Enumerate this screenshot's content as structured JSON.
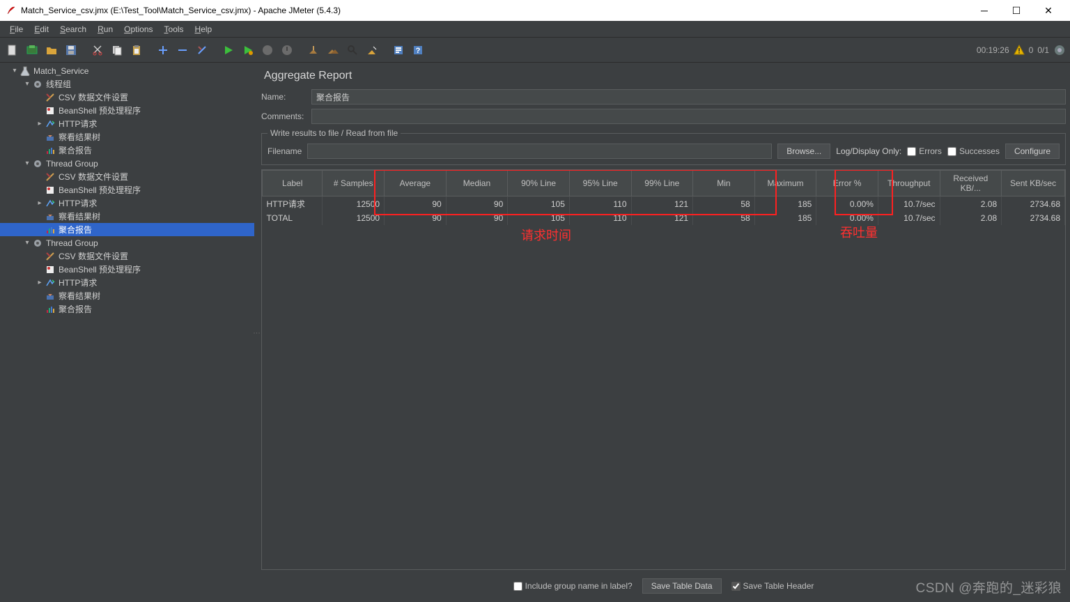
{
  "window": {
    "title": "Match_Service_csv.jmx (E:\\Test_Tool\\Match_Service_csv.jmx) - Apache JMeter (5.4.3)"
  },
  "menu": [
    "File",
    "Edit",
    "Search",
    "Run",
    "Options",
    "Tools",
    "Help"
  ],
  "toolbar_status": {
    "timer": "00:19:26",
    "warn_count": "0",
    "ratio": "0/1"
  },
  "tree": [
    {
      "depth": 0,
      "arrow": "▾",
      "icon": "flask",
      "label": "Match_Service"
    },
    {
      "depth": 1,
      "arrow": "▾",
      "icon": "gear",
      "label": "线程组"
    },
    {
      "depth": 2,
      "arrow": "",
      "icon": "csv",
      "label": "CSV 数据文件设置"
    },
    {
      "depth": 2,
      "arrow": "",
      "icon": "bean",
      "label": "BeanShell 预处理程序"
    },
    {
      "depth": 2,
      "arrow": "▸",
      "icon": "http",
      "label": "HTTP请求"
    },
    {
      "depth": 2,
      "arrow": "",
      "icon": "tree",
      "label": "察看结果树"
    },
    {
      "depth": 2,
      "arrow": "",
      "icon": "report",
      "label": "聚合报告"
    },
    {
      "depth": 1,
      "arrow": "▾",
      "icon": "gear",
      "label": "Thread Group"
    },
    {
      "depth": 2,
      "arrow": "",
      "icon": "csv",
      "label": "CSV 数据文件设置"
    },
    {
      "depth": 2,
      "arrow": "",
      "icon": "bean",
      "label": "BeanShell 预处理程序"
    },
    {
      "depth": 2,
      "arrow": "▸",
      "icon": "http",
      "label": "HTTP请求"
    },
    {
      "depth": 2,
      "arrow": "",
      "icon": "tree",
      "label": "察看结果树"
    },
    {
      "depth": 2,
      "arrow": "",
      "icon": "report",
      "label": "聚合报告",
      "selected": true
    },
    {
      "depth": 1,
      "arrow": "▾",
      "icon": "gear",
      "label": "Thread Group"
    },
    {
      "depth": 2,
      "arrow": "",
      "icon": "csv",
      "label": "CSV 数据文件设置"
    },
    {
      "depth": 2,
      "arrow": "",
      "icon": "bean",
      "label": "BeanShell 预处理程序"
    },
    {
      "depth": 2,
      "arrow": "▸",
      "icon": "http",
      "label": "HTTP请求"
    },
    {
      "depth": 2,
      "arrow": "",
      "icon": "tree",
      "label": "察看结果树"
    },
    {
      "depth": 2,
      "arrow": "",
      "icon": "report",
      "label": "聚合报告"
    }
  ],
  "panel": {
    "title": "Aggregate Report",
    "name_label": "Name:",
    "name_value": "聚合报告",
    "comments_label": "Comments:",
    "comments_value": "",
    "file_legend": "Write results to file / Read from file",
    "filename_label": "Filename",
    "filename_value": "",
    "browse_label": "Browse...",
    "logdisplay_label": "Log/Display Only:",
    "errors_label": "Errors",
    "successes_label": "Successes",
    "configure_label": "Configure"
  },
  "table": {
    "headers": [
      "Label",
      "# Samples",
      "Average",
      "Median",
      "90% Line",
      "95% Line",
      "99% Line",
      "Min",
      "Maximum",
      "Error %",
      "Throughput",
      "Received KB/...",
      "Sent KB/sec"
    ],
    "rows": [
      [
        "HTTP请求",
        "12500",
        "90",
        "90",
        "105",
        "110",
        "121",
        "58",
        "185",
        "0.00%",
        "10.7/sec",
        "2.08",
        "2734.68"
      ],
      [
        "TOTAL",
        "12500",
        "90",
        "90",
        "105",
        "110",
        "121",
        "58",
        "185",
        "0.00%",
        "10.7/sec",
        "2.08",
        "2734.68"
      ]
    ]
  },
  "annotations": {
    "time": "请求时间",
    "throughput": "吞吐量"
  },
  "bottom": {
    "include_group_label": "Include group name in label?",
    "save_table_data": "Save Table Data",
    "save_table_header": "Save Table Header"
  },
  "watermark": "CSDN @奔跑的_迷彩狼"
}
